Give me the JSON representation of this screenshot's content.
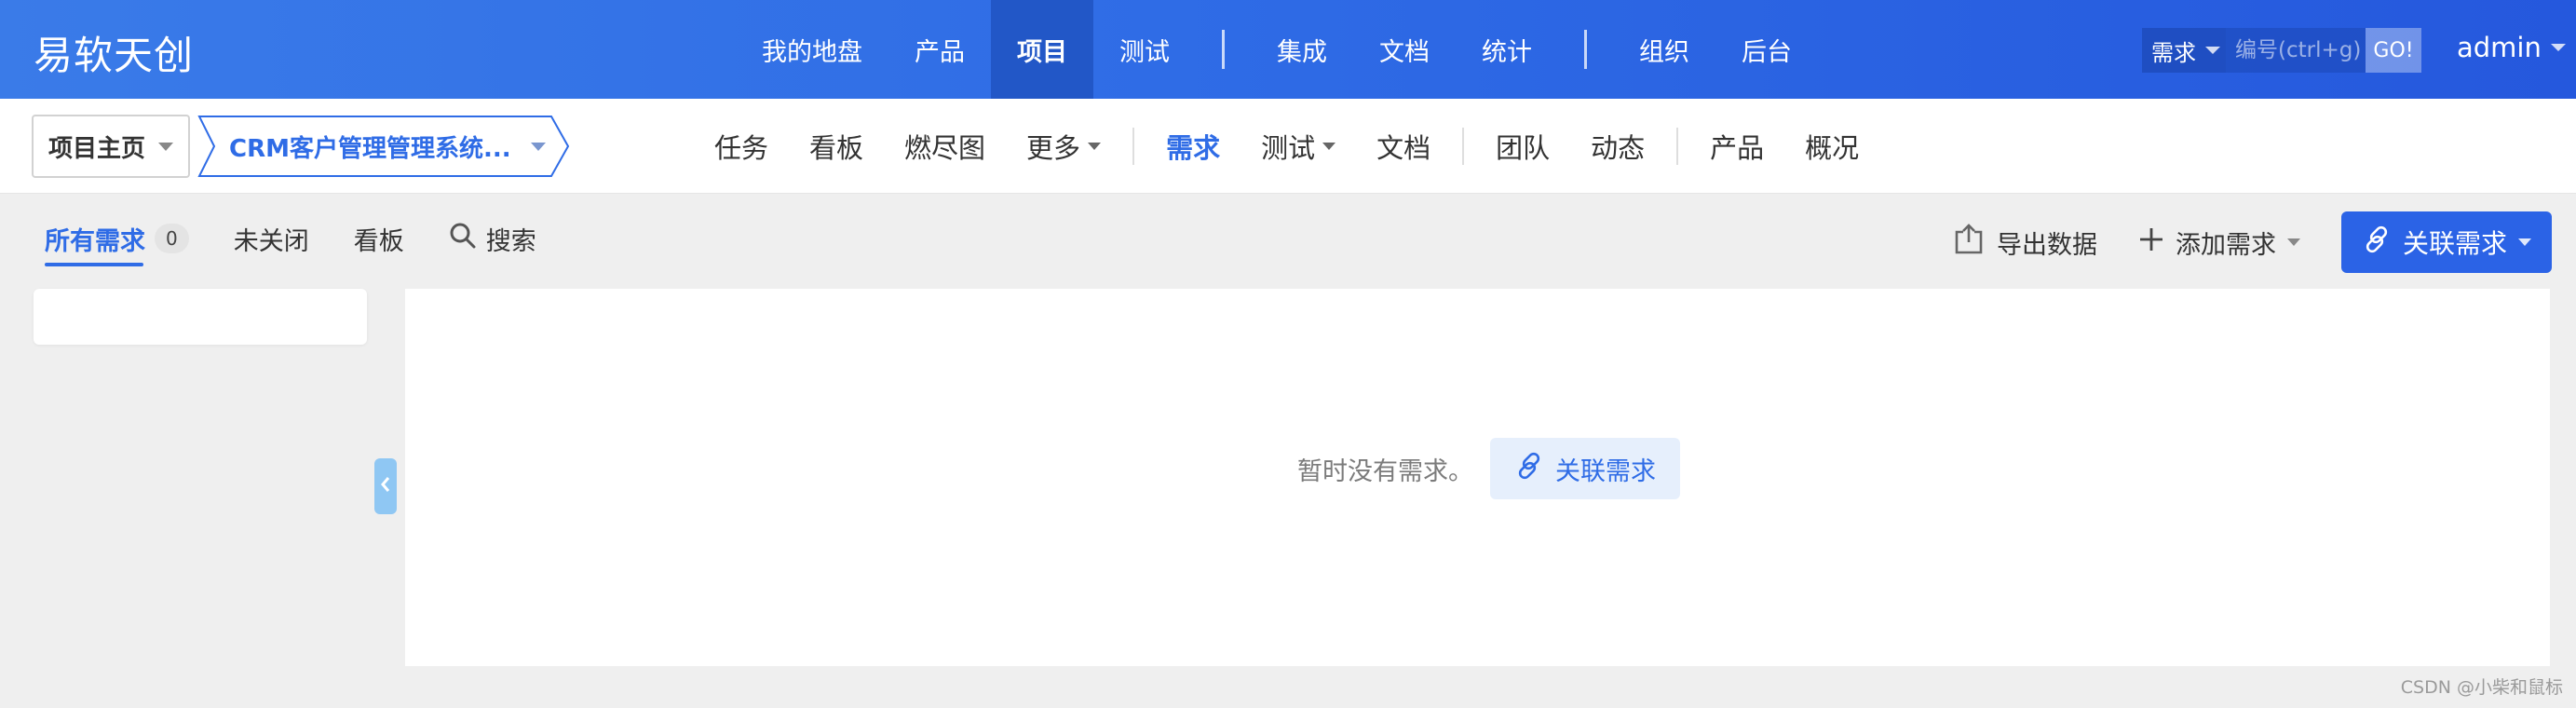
{
  "brand": "易软天创",
  "main_nav": [
    {
      "label": "我的地盘"
    },
    {
      "label": "产品"
    },
    {
      "label": "项目",
      "active": true
    },
    {
      "label": "测试"
    },
    {
      "sep": true
    },
    {
      "label": "集成"
    },
    {
      "label": "文档"
    },
    {
      "label": "统计"
    },
    {
      "sep": true
    },
    {
      "label": "组织"
    },
    {
      "label": "后台"
    }
  ],
  "search": {
    "type": "需求",
    "placeholder": "编号(ctrl+g)",
    "go": "GO!"
  },
  "user": "admin",
  "breadcrumb": {
    "home": "项目主页",
    "project": "CRM客户管理管理系统..."
  },
  "sub_nav": [
    {
      "label": "任务"
    },
    {
      "label": "看板"
    },
    {
      "label": "燃尽图"
    },
    {
      "label": "更多",
      "dropdown": true
    },
    {
      "sep": true
    },
    {
      "label": "需求",
      "active": true
    },
    {
      "label": "测试",
      "dropdown": true
    },
    {
      "label": "文档"
    },
    {
      "sep": true
    },
    {
      "label": "团队"
    },
    {
      "label": "动态"
    },
    {
      "sep": true
    },
    {
      "label": "产品"
    },
    {
      "label": "概况"
    }
  ],
  "tabs": {
    "all": "所有需求",
    "all_count": "0",
    "unclosed": "未关闭",
    "board": "看板",
    "search": "搜索"
  },
  "actions": {
    "export": "导出数据",
    "add": "添加需求",
    "link": "关联需求"
  },
  "empty": {
    "text": "暂时没有需求。",
    "link": "关联需求"
  },
  "watermark": "CSDN @小柴和鼠标",
  "colors": {
    "primary": "#2b63e6",
    "topbar_start": "#3a7be8",
    "topbar_end": "#2558dd",
    "background": "#efefef"
  }
}
